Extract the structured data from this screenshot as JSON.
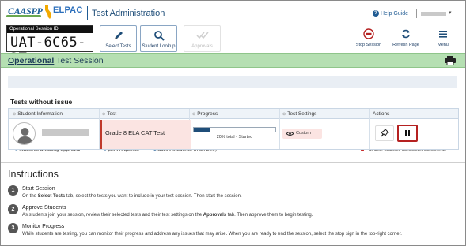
{
  "header": {
    "logo_caaspp": "CAASPP",
    "logo_elpac": "ELPAC",
    "app_title": "Test Administration",
    "help_label": "Help Guide",
    "user_caret": "▾"
  },
  "toolbar": {
    "session_id_label": "Operational Session ID",
    "session_id": "UAT-6C65-3T",
    "buttons": [
      {
        "label": "Select Tests",
        "icon": "pencil-icon",
        "enabled": true
      },
      {
        "label": "Student Lookup",
        "icon": "search-icon",
        "enabled": true
      },
      {
        "label": "Approvals",
        "icon": "checkmarks-icon",
        "enabled": false
      }
    ],
    "right_buttons": [
      {
        "label": "Stop Session",
        "icon": "stop-icon"
      },
      {
        "label": "Refresh Page",
        "icon": "refresh-icon"
      },
      {
        "label": "Menu",
        "icon": "hamburger-icon"
      }
    ]
  },
  "session": {
    "title_bold": "Operational",
    "title_rest": " Test Session"
  },
  "status": {
    "awaiting_count": "0",
    "awaiting_label": " students awaiting approval",
    "print_count": "0",
    "print_label": " print requests",
    "active_count": "1",
    "active_label": " active students (max 200)",
    "legend": "= Smarter Balanced Summative Assessments"
  },
  "tests_without_issue": {
    "title": "Tests without issue",
    "columns": [
      "Student Information",
      "Test",
      "Progress",
      "Test Settings",
      "Actions"
    ],
    "rows": [
      {
        "test": "Grade 8 ELA CAT Test",
        "progress_percent": 20,
        "progress_text": "20% total  -  Started",
        "settings": "Custom"
      }
    ]
  },
  "instructions": {
    "title": "Instructions",
    "steps": [
      {
        "num": "1",
        "title": "Start Session",
        "desc_pre": "On the ",
        "desc_bold": "Select Tests",
        "desc_post": " tab, select the tests you want to include in your test session. Then start the session."
      },
      {
        "num": "2",
        "title": "Approve Students",
        "desc_pre": "As students join your session, review their selected tests and their test settings on the ",
        "desc_bold": "Approvals",
        "desc_post": " tab. Then approve them to begin testing."
      },
      {
        "num": "3",
        "title": "Monitor Progress",
        "desc_pre": "While students are testing, you can monitor their progress and address any issues that may arise. When you are ready to end the session, select the stop sign in the top-right corner.",
        "desc_bold": "",
        "desc_post": ""
      }
    ]
  },
  "colors": {
    "banner": "#b5dfb2",
    "brand_blue": "#1f4e79",
    "test_cell": "#fbe4e2",
    "pause_border": "#b52121"
  }
}
